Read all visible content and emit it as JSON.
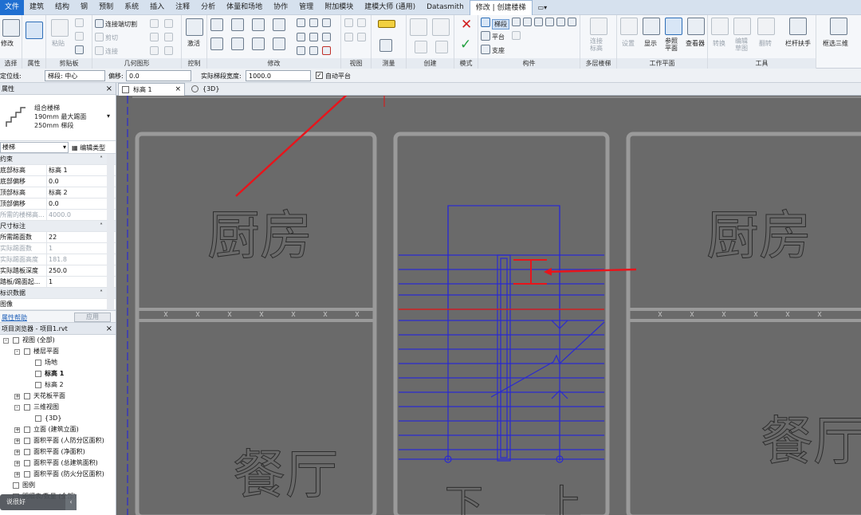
{
  "ribbon_tabs": [
    "文件",
    "建筑",
    "结构",
    "钢",
    "预制",
    "系统",
    "插入",
    "注释",
    "分析",
    "体量和场地",
    "协作",
    "管理",
    "附加模块",
    "建模大师 (通用)",
    "Datasmith",
    "修改 | 创建楼梯",
    "▭▾"
  ],
  "active_tab": "修改 | 创建楼梯",
  "ribbon": {
    "panel_select": "选择",
    "modify_label": "修改",
    "panel_properties": "属性",
    "panel_clipboard": "剪贴板",
    "paste_label": "粘贴",
    "join_cut": "连接端切割",
    "cut": "剪切",
    "join": "连接",
    "panel_geometry": "几何图形",
    "panel_control": "控制",
    "activate_label": "激活",
    "panel_modify": "修改",
    "panel_view": "视图",
    "panel_measure": "测量",
    "panel_create": "创建",
    "panel_mode": "模式",
    "run_label": "梯段",
    "landing_label": "平台",
    "support_label": "支座",
    "panel_components": "构件",
    "connect_label": "连接标高",
    "panel_multistory": "多层楼梯",
    "set_label": "设置",
    "show_label": "显示",
    "ref_plane_label": "参照平面",
    "viewer_label": "查看器",
    "panel_workplane": "工作平面",
    "convert_label": "转换",
    "edit_sketch_label": "编辑草图",
    "flip_label": "翻转",
    "railing_label": "栏杆扶手",
    "box3d_label": "框选三维",
    "panel_tools": "工具"
  },
  "options_bar": {
    "locate_label": "定位线:",
    "locate_value": "梯段: 中心",
    "offset_label": "偏移:",
    "offset_value": "0.0",
    "width_label": "实际梯段宽度:",
    "width_value": "1000.0",
    "auto_landing_label": "自动平台"
  },
  "properties": {
    "title": "属性",
    "type_line1": "组合楼梯",
    "type_line2": "190mm 最大踢面",
    "type_line3": "250mm 梯段",
    "selector": "楼梯",
    "edit_type": "编辑类型",
    "sections": [
      {
        "title": "约束",
        "rows": [
          {
            "k": "底部标高",
            "v": "标高 1",
            "dim": false
          },
          {
            "k": "底部偏移",
            "v": "0.0",
            "dim": false
          },
          {
            "k": "顶部标高",
            "v": "标高 2",
            "dim": false
          },
          {
            "k": "顶部偏移",
            "v": "0.0",
            "dim": false
          },
          {
            "k": "所需的楼梯高...",
            "v": "4000.0",
            "dim": true
          }
        ]
      },
      {
        "title": "尺寸标注",
        "rows": [
          {
            "k": "所需踢面数",
            "v": "22",
            "dim": false
          },
          {
            "k": "实际踢面数",
            "v": "1",
            "dim": true
          },
          {
            "k": "实际踢面高度",
            "v": "181.8",
            "dim": true
          },
          {
            "k": "实际踏板深度",
            "v": "250.0",
            "dim": false
          },
          {
            "k": "踏板/踢面起...",
            "v": "1",
            "dim": false
          }
        ]
      },
      {
        "title": "标识数据",
        "rows": [
          {
            "k": "图像",
            "v": "",
            "dim": false
          }
        ]
      }
    ],
    "help_link": "属性帮助",
    "apply": "应用"
  },
  "browser": {
    "title": "项目浏览器 - 项目1.rvt",
    "nodes": [
      {
        "label": "视图 (全部)",
        "level": 0,
        "toggle": "-",
        "sel": false
      },
      {
        "label": "楼层平面",
        "level": 1,
        "toggle": "-",
        "sel": false
      },
      {
        "label": "场地",
        "level": 2,
        "toggle": "",
        "sel": false
      },
      {
        "label": "标高 1",
        "level": 2,
        "toggle": "",
        "sel": true
      },
      {
        "label": "标高 2",
        "level": 2,
        "toggle": "",
        "sel": false
      },
      {
        "label": "天花板平面",
        "level": 1,
        "toggle": "+",
        "sel": false
      },
      {
        "label": "三维视图",
        "level": 1,
        "toggle": "-",
        "sel": false
      },
      {
        "label": "{3D}",
        "level": 2,
        "toggle": "",
        "sel": false
      },
      {
        "label": "立面 (建筑立面)",
        "level": 1,
        "toggle": "+",
        "sel": false
      },
      {
        "label": "面积平面 (人防分区面积)",
        "level": 1,
        "toggle": "+",
        "sel": false
      },
      {
        "label": "面积平面 (净面积)",
        "level": 1,
        "toggle": "+",
        "sel": false
      },
      {
        "label": "面积平面 (总建筑面积)",
        "level": 1,
        "toggle": "+",
        "sel": false
      },
      {
        "label": "面积平面 (防火分区面积)",
        "level": 1,
        "toggle": "+",
        "sel": false
      },
      {
        "label": "图例",
        "level": 0,
        "toggle": "",
        "sel": false
      },
      {
        "label": "明细表/数量 (全部)",
        "level": 0,
        "toggle": "",
        "sel": false
      }
    ]
  },
  "status_bubble": "说很好",
  "view_tabs": [
    {
      "label": "标高 1",
      "active": true
    },
    {
      "label": "{3D}",
      "active": false
    }
  ],
  "canvas": {
    "room_kitchen": "厨房",
    "room_dining": "餐厅",
    "mark_down": "下",
    "mark_up": "上"
  },
  "colors": {
    "canvas_bg": "#6a6a6a",
    "wall": "#9a9a9a",
    "stair_line": "#2a2ad0",
    "red_line": "#d02020",
    "arrow_red": "#e8141b",
    "ribbon_active": "#ffffff",
    "file_tab": "#1f6fd1"
  }
}
